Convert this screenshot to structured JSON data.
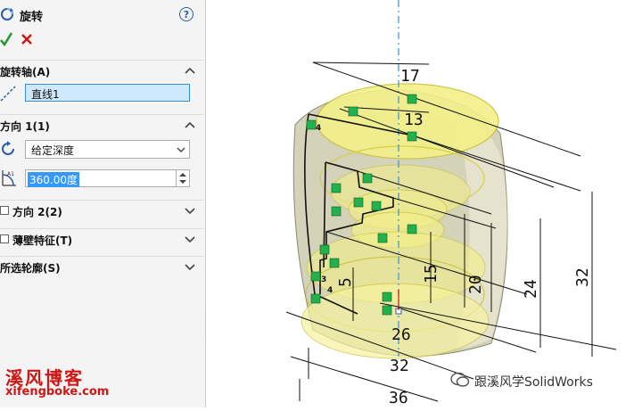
{
  "panel": {
    "title": "旋转",
    "help": "?",
    "sections": {
      "axis": {
        "label": "旋转轴(A)",
        "value": "直线1"
      },
      "direction1": {
        "label": "方向 1(1)",
        "end_condition": "给定深度",
        "angle": "360.00度"
      },
      "direction2": {
        "label": "方向 2(2)"
      },
      "thin": {
        "label": "薄壁特征(T)"
      },
      "contours": {
        "label": "所选轮廓(S)"
      }
    }
  },
  "viewport": {
    "dimensions": [
      "17",
      "13",
      "15",
      "20",
      "24",
      "32",
      "5",
      "26",
      "32",
      "36"
    ],
    "markers": [
      "4",
      "4",
      "3"
    ]
  },
  "watermark": {
    "left_title": "溪风博客",
    "left_url": "xifengboke.com",
    "right_text": "跟溪风学SolidWorks"
  },
  "colors": {
    "accent_blue": "#3b8fd6",
    "ok_green": "#1a9a2a",
    "cancel_red": "#d01515",
    "model_yellow": "#f3f08a",
    "relation_green": "#22b14c"
  }
}
